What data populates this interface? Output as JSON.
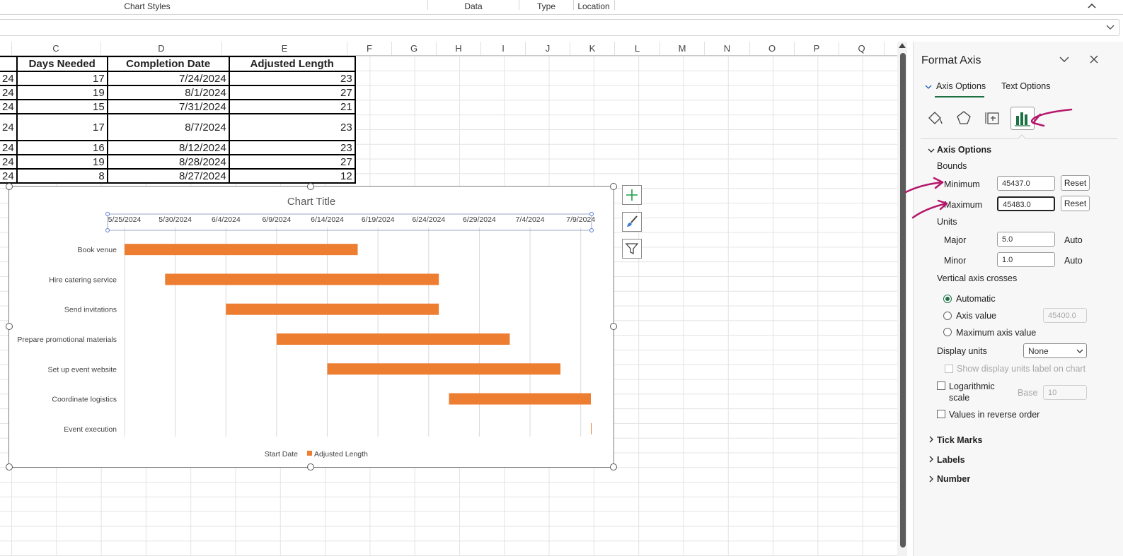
{
  "ribbon": {
    "groups": [
      "Chart Styles",
      "Data",
      "Type",
      "Location"
    ]
  },
  "sheet": {
    "columns": [
      "C",
      "D",
      "E",
      "F",
      "G",
      "H",
      "I",
      "J",
      "K",
      "L",
      "M",
      "N",
      "O",
      "P",
      "Q"
    ],
    "row_label_stub": "24",
    "headers": [
      "Days Needed",
      "Completion Date",
      "Adjusted Length"
    ],
    "rows": [
      [
        "17",
        "7/24/2024",
        "23"
      ],
      [
        "19",
        "8/1/2024",
        "27"
      ],
      [
        "15",
        "7/31/2024",
        "21"
      ],
      [
        "17",
        "8/7/2024",
        "23"
      ],
      [
        "16",
        "8/12/2024",
        "23"
      ],
      [
        "19",
        "8/28/2024",
        "27"
      ],
      [
        "8",
        "8/27/2024",
        "12"
      ]
    ]
  },
  "chart_data": {
    "type": "bar",
    "orientation": "horizontal-stacked",
    "title": "Chart Title",
    "x_axis_position": "top",
    "xlim": [
      "2024-05-25",
      "2024-07-10"
    ],
    "tick_labels": [
      "5/25/2024",
      "5/30/2024",
      "6/4/2024",
      "6/9/2024",
      "6/14/2024",
      "6/19/2024",
      "6/24/2024",
      "6/29/2024",
      "7/4/2024",
      "7/9/2024"
    ],
    "categories": [
      "Book venue",
      "Hire catering service",
      "Send invitations",
      "Prepare promotional materials",
      "Set up event website",
      "Coordinate logistics",
      "Event execution"
    ],
    "series": [
      {
        "name": "Start Date",
        "color": "none",
        "values": [
          "2024-05-25",
          "2024-05-29",
          "2024-06-04",
          "2024-06-09",
          "2024-06-14",
          "2024-06-26",
          "2024-07-10"
        ]
      },
      {
        "name": "Adjusted Length",
        "color": "#ed7d31",
        "values": [
          23,
          27,
          21,
          23,
          23,
          27,
          12
        ]
      }
    ],
    "legend": "bottom",
    "grid": true
  },
  "pane": {
    "title": "Format Axis",
    "tab_axis": "Axis Options",
    "tab_text": "Text Options",
    "icons": [
      "fill-line-icon",
      "effects-icon",
      "size-properties-icon",
      "axis-options-icon"
    ],
    "section_axis": "Axis Options",
    "bounds": "Bounds",
    "min_label": "Minimum",
    "min_value": "45437.0",
    "max_label": "Maximum",
    "max_value": "45483.0",
    "reset": "Reset",
    "units": "Units",
    "major_label": "Major",
    "major_value": "5.0",
    "minor_label": "Minor",
    "minor_value": "1.0",
    "auto": "Auto",
    "crosses": "Vertical axis crosses",
    "opt_automatic": "Automatic",
    "opt_axis_value": "Axis value",
    "axis_value": "45400.0",
    "opt_max": "Maximum axis value",
    "display_units": "Display units",
    "display_units_value": "None",
    "show_units_label": "Show display units label on chart",
    "log_scale_1": "Logarithmic",
    "log_scale_2": "scale",
    "base_label": "Base",
    "base_value": "10",
    "reverse": "Values in reverse order",
    "tick_marks": "Tick Marks",
    "labels": "Labels",
    "number": "Number"
  },
  "colors": {
    "bar": "#ed7d31",
    "accent_green": "#1e7145",
    "annotation_arrow": "#b5176b"
  }
}
